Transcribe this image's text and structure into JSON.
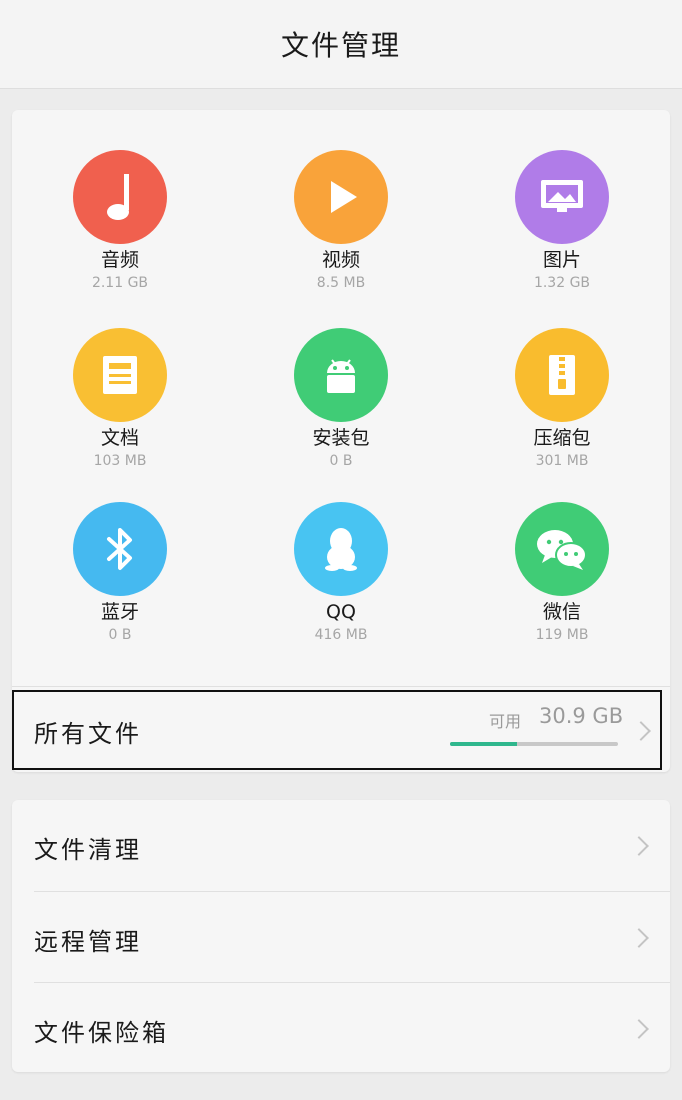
{
  "header": {
    "title": "文件管理"
  },
  "categories": [
    {
      "label": "音频",
      "size": "2.11 GB",
      "icon": "music-note-icon",
      "color": "#f0604e"
    },
    {
      "label": "视频",
      "size": "8.5 MB",
      "icon": "play-icon",
      "color": "#f9a33a"
    },
    {
      "label": "图片",
      "size": "1.32 GB",
      "icon": "picture-icon",
      "color": "#b07ce8"
    },
    {
      "label": "文档",
      "size": "103 MB",
      "icon": "document-icon",
      "color": "#f9bf33"
    },
    {
      "label": "安装包",
      "size": "0 B",
      "icon": "android-icon",
      "color": "#40cc76"
    },
    {
      "label": "压缩包",
      "size": "301 MB",
      "icon": "zip-icon",
      "color": "#f9bc2e"
    },
    {
      "label": "蓝牙",
      "size": "0 B",
      "icon": "bluetooth-icon",
      "color": "#45b9f0"
    },
    {
      "label": "QQ",
      "size": "416 MB",
      "icon": "qq-penguin-icon",
      "color": "#48c4f2"
    },
    {
      "label": "微信",
      "size": "119 MB",
      "icon": "wechat-icon",
      "color": "#40cc76"
    }
  ],
  "all_files": {
    "label": "所有文件",
    "available_label": "可用",
    "available_value": "30.9 GB",
    "used_fraction": 0.4,
    "accent_color": "#2fb78d"
  },
  "tools": [
    {
      "label": "文件清理"
    },
    {
      "label": "远程管理"
    },
    {
      "label": "文件保险箱"
    }
  ]
}
